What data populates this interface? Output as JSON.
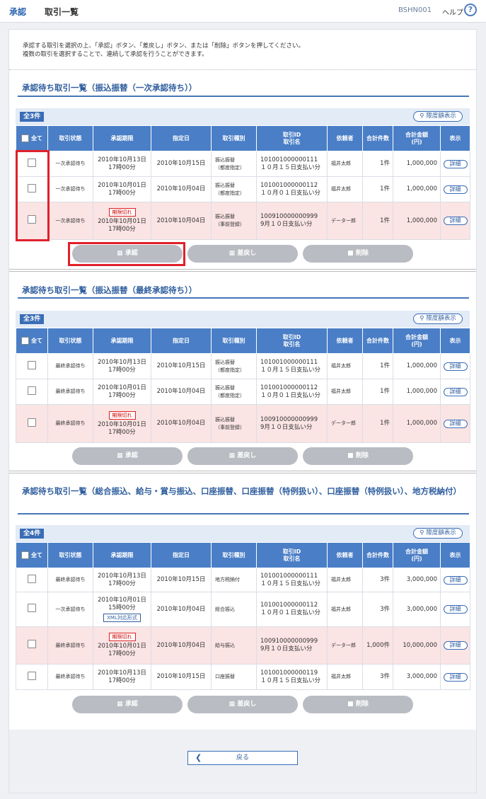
{
  "header": {
    "crumb1": "承認",
    "crumb2": "取引一覧",
    "screen_code": "BSHN001",
    "help_label": "ヘルプ",
    "help_icon": "?"
  },
  "intro": {
    "line1": "承認する取引を選択の上、「承認」ボタン、「差戻し」ボタン、または「削除」ボタンを押してください。",
    "line2": "複数の取引を選択することで、連続して承認を行うことができます。"
  },
  "columns": [
    "全て",
    "取引状態",
    "承認期限",
    "指定日",
    "取引種別",
    "取引ID\n取引名",
    "依頼者",
    "合計件数",
    "合計金額\n(円)",
    "表示"
  ],
  "limit_label": "限度額表示",
  "detail_label": "詳細",
  "expired_label": "期限切れ",
  "buttons": {
    "approve": "承認",
    "return": "差戻し",
    "delete": "削除",
    "back": "戻る"
  },
  "sections": [
    {
      "title": "承認待ち取引一覧（振込振替（一次承認待ち））",
      "count": "全3件",
      "rows": [
        {
          "status": "一次承認待ち",
          "deadline1": "2010年10月13日",
          "deadline2": "17時00分",
          "date": "2010年10月15日",
          "type1": "振込振替",
          "type2": "（都度指定）",
          "id": "101001000000111",
          "name": "１０月１５日支払い分",
          "requester": "福井太郎",
          "count": "1件",
          "amount": "1,000,000",
          "expired": false
        },
        {
          "status": "一次承認待ち",
          "deadline1": "2010年10月01日",
          "deadline2": "17時00分",
          "date": "2010年10月04日",
          "type1": "振込振替",
          "type2": "（都度指定）",
          "id": "101001000000112",
          "name": "１０月０１日支払い分",
          "requester": "福井太郎",
          "count": "1件",
          "amount": "1,000,000",
          "expired": false
        },
        {
          "status": "一次承認待ち",
          "deadline1": "2010年10月01日",
          "deadline2": "17時00分",
          "date": "2010年10月04日",
          "type1": "振込振替",
          "type2": "（事前登録）",
          "id": "100910000000999",
          "name": "9月１０日支払い分",
          "requester": "データー郎",
          "count": "1件",
          "amount": "1,000,000",
          "expired": true
        }
      ]
    },
    {
      "title": "承認待ち取引一覧（振込振替（最終承認待ち））",
      "count": "全3件",
      "rows": [
        {
          "status": "最終承認待ち",
          "deadline1": "2010年10月13日",
          "deadline2": "17時00分",
          "date": "2010年10月15日",
          "type1": "振込振替",
          "type2": "（都度指定）",
          "id": "101001000000111",
          "name": "１０月１５日支払い分",
          "requester": "福井太郎",
          "count": "1件",
          "amount": "1,000,000",
          "expired": false
        },
        {
          "status": "最終承認待ち",
          "deadline1": "2010年10月01日",
          "deadline2": "17時00分",
          "date": "2010年10月04日",
          "type1": "振込振替",
          "type2": "（都度指定）",
          "id": "101001000000112",
          "name": "１０月０１日支払い分",
          "requester": "福井太郎",
          "count": "1件",
          "amount": "1,000,000",
          "expired": false
        },
        {
          "status": "最終承認待ち",
          "deadline1": "2010年10月01日",
          "deadline2": "17時00分",
          "date": "2010年10月04日",
          "type1": "振込振替",
          "type2": "（事前登録）",
          "id": "100910000000999",
          "name": "9月１０日支払い分",
          "requester": "データー郎",
          "count": "1件",
          "amount": "1,000,000",
          "expired": true
        }
      ]
    },
    {
      "title": "承認待ち取引一覧（総合振込、給与・賞与振込、口座振替、口座振替（特例扱い）、口座振替（特例扱い）、地方税納付）",
      "count": "全4件",
      "rows": [
        {
          "status": "最終承認待ち",
          "deadline1": "2010年10月13日",
          "deadline2": "17時00分",
          "date": "2010年10月15日",
          "type1": "地方税納付",
          "type2": "",
          "id": "101001000000111",
          "name": "１０月１５日支払い分",
          "requester": "福井太郎",
          "count": "3件",
          "amount": "3,000,000",
          "expired": false
        },
        {
          "status": "一次承認待ち",
          "deadline1": "2010年10月01日",
          "deadline2": "15時00分",
          "xml": "XML対応形式",
          "date": "2010年10月04日",
          "type1": "総合振込",
          "type2": "",
          "id": "101001000000112",
          "name": "１０月０１日支払い分",
          "requester": "福井太郎",
          "count": "3件",
          "amount": "3,000,000",
          "expired": false
        },
        {
          "status": "最終承認待ち",
          "deadline1": "2010年10月01日",
          "deadline2": "17時00分",
          "date": "2010年10月04日",
          "type1": "給与振込",
          "type2": "",
          "id": "100910000000999",
          "name": "9月１０日支払い分",
          "requester": "データー郎",
          "count": "1,000件",
          "amount": "10,000,000",
          "expired": true
        },
        {
          "status": "最終承認待ち",
          "deadline1": "2010年10月13日",
          "deadline2": "17時00分",
          "date": "2010年10月15日",
          "type1": "口座振替",
          "type2": "",
          "id": "101001000000119",
          "name": "１０月１５日支払い分",
          "requester": "福井太郎",
          "count": "3件",
          "amount": "3,000,000",
          "expired": false
        }
      ]
    }
  ]
}
